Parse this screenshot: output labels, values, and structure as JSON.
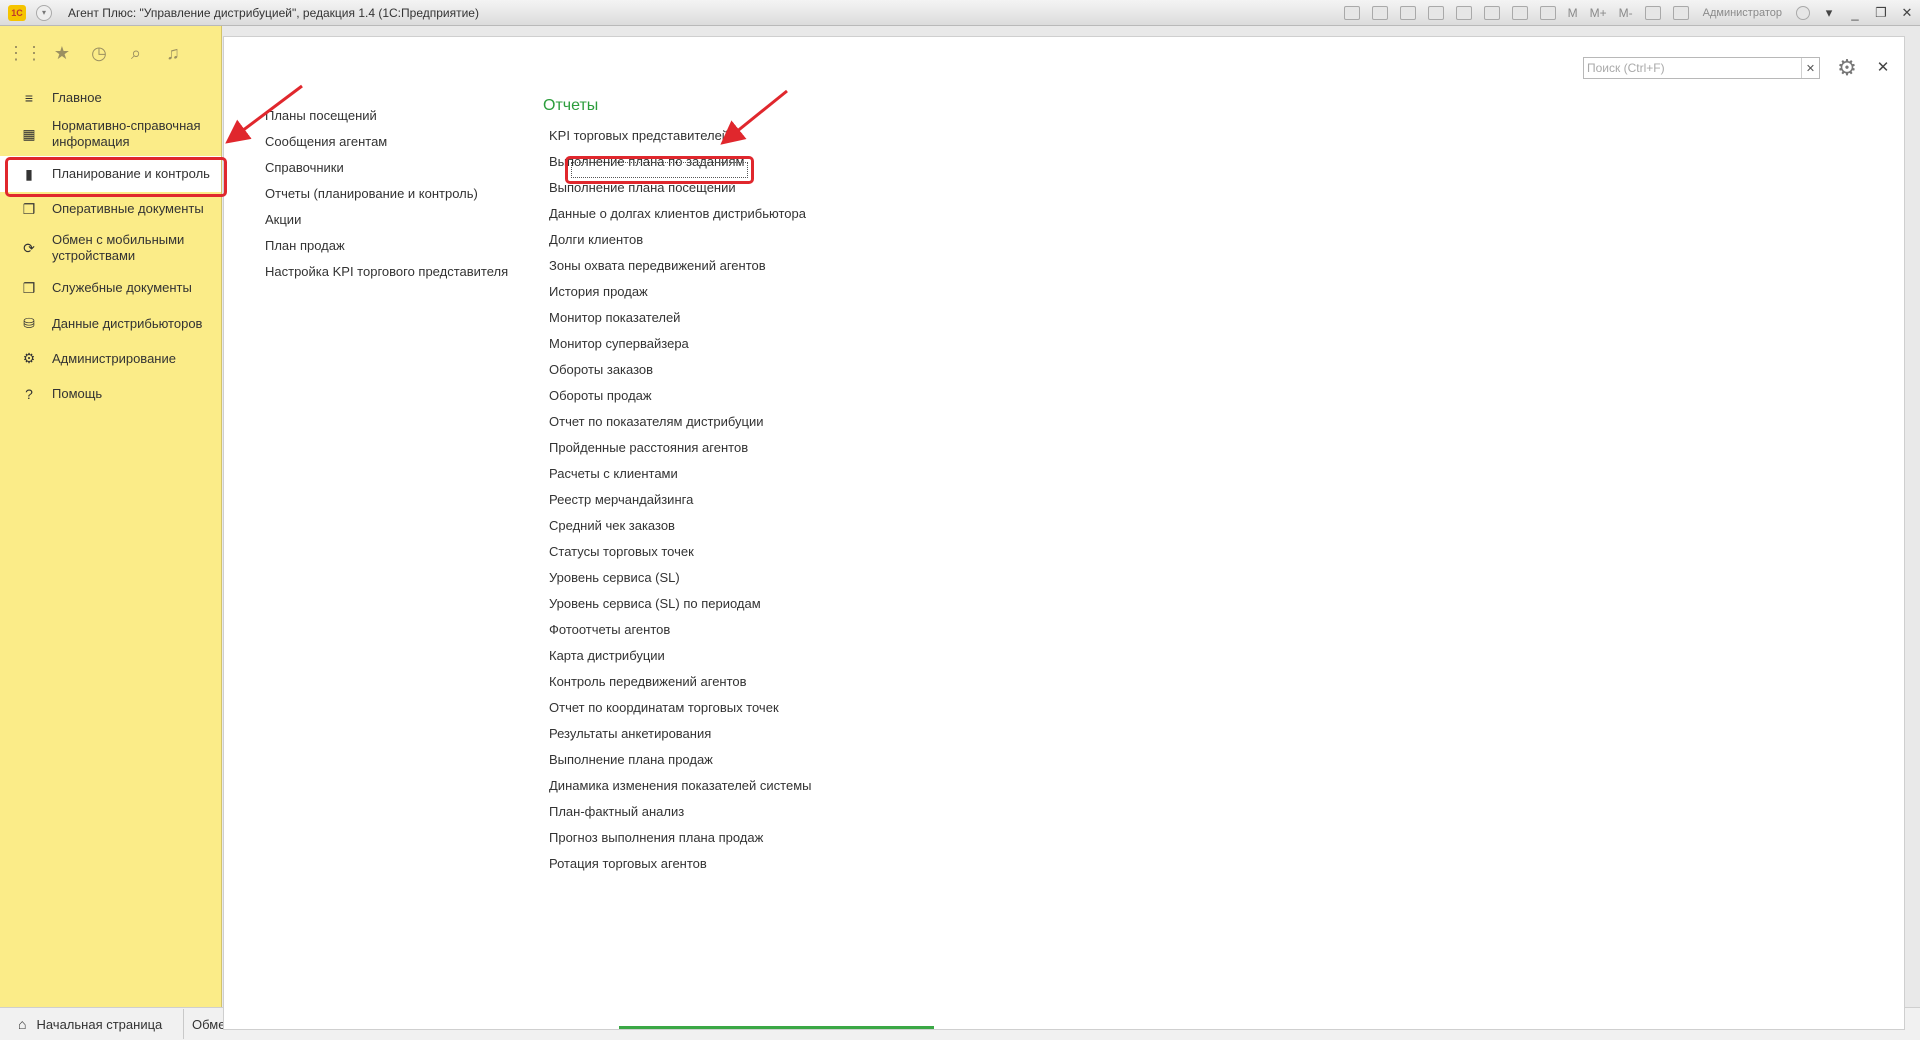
{
  "window": {
    "logo": "1С",
    "title": "Агент Плюс: \"Управление дистрибуцией\", редакция 1.4  (1С:Предприятие)",
    "toolbar_marks": [
      "M",
      "M+",
      "M-"
    ],
    "user": "Администратор"
  },
  "sidebar": {
    "tools": [
      "apps-grid-icon",
      "star-icon",
      "history-icon",
      "search-icon",
      "bell-icon"
    ],
    "items": [
      {
        "label": "Главное",
        "icon": "≡"
      },
      {
        "label": "Нормативно-справочная информация",
        "icon": "▦"
      },
      {
        "label": "Планирование и контроль",
        "icon": "▮"
      },
      {
        "label": "Оперативные документы",
        "icon": "❐"
      },
      {
        "label": "Обмен с мобильными устройствами",
        "icon": "⟳"
      },
      {
        "label": "Служебные документы",
        "icon": "❐"
      },
      {
        "label": "Данные дистрибьюторов",
        "icon": "⛁"
      },
      {
        "label": "Администрирование",
        "icon": "⚙"
      },
      {
        "label": "Помощь",
        "icon": "?"
      }
    ],
    "active_index": 2
  },
  "bottom_tabs": {
    "home": "Начальная страница",
    "next": "Обме"
  },
  "search": {
    "placeholder": "Поиск (Ctrl+F)",
    "value": ""
  },
  "left_links": [
    "Планы посещений",
    "Сообщения агентам",
    "Справочники",
    "Отчеты (планирование и контроль)",
    "Акции",
    "План продаж",
    "Настройка KPI торгового представителя"
  ],
  "reports": {
    "title": "Отчеты",
    "items": [
      "KPI торговых представителей",
      "Выполнение плана по заданиям",
      "Выполнение плана посещений",
      "Данные о долгах клиентов дистрибьютора",
      "Долги клиентов",
      "Зоны охвата передвижений агентов",
      "История продаж",
      "Монитор показателей",
      "Монитор супервайзера",
      "Обороты заказов",
      "Обороты продаж",
      "Отчет по показателям дистрибуции",
      "Пройденные расстояния агентов",
      "Расчеты с клиентами",
      "Реестр мерчандайзинга",
      "Средний чек заказов",
      "Статусы торговых точек",
      "Уровень сервиса (SL)",
      "Уровень сервиса (SL) по периодам",
      "Фотоотчеты агентов",
      "Карта дистрибуции",
      "Контроль передвижений агентов",
      "Отчет по координатам торговых точек",
      "Результаты анкетирования",
      "Выполнение плана продаж",
      "Динамика изменения показателей системы",
      "План-фактный анализ",
      "Прогноз выполнения плана продаж",
      "Ротация торговых агентов"
    ]
  },
  "colors": {
    "sidebar_bg": "#fbec88",
    "accent_green": "#2c9d3c",
    "annotation_red": "#e0272d"
  }
}
